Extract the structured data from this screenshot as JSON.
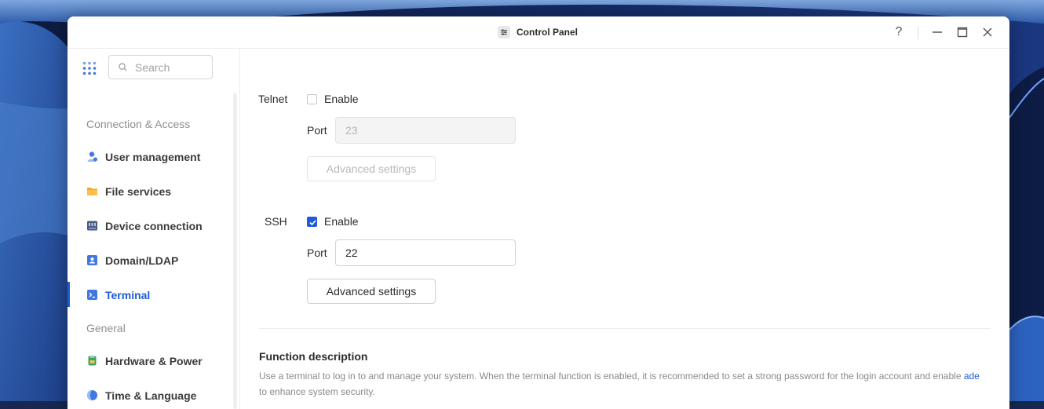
{
  "window": {
    "title": "Control Panel",
    "help_label": "?"
  },
  "sidebar": {
    "search_placeholder": "Search",
    "sections": [
      {
        "label": "Connection & Access"
      },
      {
        "label": "General"
      }
    ],
    "items": [
      {
        "label": "User management",
        "icon": "user-management-icon"
      },
      {
        "label": "File services",
        "icon": "folder-icon"
      },
      {
        "label": "Device connection",
        "icon": "device-icon"
      },
      {
        "label": "Domain/LDAP",
        "icon": "domain-icon"
      },
      {
        "label": "Terminal",
        "icon": "terminal-icon",
        "active": true
      },
      {
        "label": "Hardware & Power",
        "icon": "hardware-icon"
      },
      {
        "label": "Time & Language",
        "icon": "globe-icon"
      }
    ]
  },
  "telnet": {
    "label": "Telnet",
    "enable_label": "Enable",
    "enabled": false,
    "port_label": "Port",
    "port_value": "23",
    "advanced_label": "Advanced settings"
  },
  "ssh": {
    "label": "SSH",
    "enable_label": "Enable",
    "enabled": true,
    "port_label": "Port",
    "port_value": "22",
    "advanced_label": "Advanced settings"
  },
  "description": {
    "title": "Function description",
    "text_before": "Use a terminal to log in to and manage your system. When the terminal function is enabled, it is recommended to set a strong password for the login account and enable ",
    "link": "ade",
    "text_after": " to enhance system security."
  },
  "colors": {
    "accent": "#1f5bd8"
  }
}
